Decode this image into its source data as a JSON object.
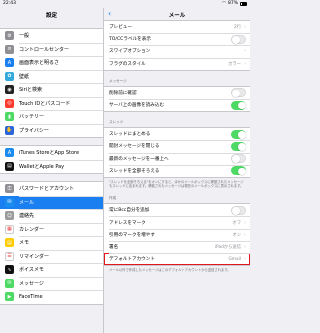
{
  "status": {
    "time": "22:43",
    "battery": "87%"
  },
  "left": {
    "title": "設定",
    "groups": [
      [
        {
          "label": "一般",
          "icon": "gear-icon",
          "color": "#8e8e93"
        },
        {
          "label": "コントロールセンター",
          "icon": "switches-icon",
          "color": "#8e8e93"
        },
        {
          "label": "画面表示と明るさ",
          "icon": "aa-icon",
          "color": "#1a7ff0"
        },
        {
          "label": "壁紙",
          "icon": "flower-icon",
          "color": "#34aadc"
        },
        {
          "label": "Siriと検索",
          "icon": "siri-icon",
          "color": "#222"
        },
        {
          "label": "Touch IDとパスコード",
          "icon": "fingerprint-icon",
          "color": "#ff3b30"
        },
        {
          "label": "バッテリー",
          "icon": "battery-icon",
          "color": "#4cd964"
        },
        {
          "label": "プライバシー",
          "icon": "hand-icon",
          "color": "#2a66d9"
        }
      ],
      [
        {
          "label": "iTunes StoreとApp Store",
          "icon": "appstore-icon",
          "color": "#1a8cf0"
        },
        {
          "label": "WalletとApple Pay",
          "icon": "wallet-icon",
          "color": "#111"
        }
      ],
      [
        {
          "label": "パスワードとアカウント",
          "icon": "key-icon",
          "color": "#8e8e93"
        },
        {
          "label": "メール",
          "icon": "mail-icon",
          "color": "#1a8cf0",
          "selected": true
        },
        {
          "label": "連絡先",
          "icon": "contacts-icon",
          "color": "#9b9b9b"
        },
        {
          "label": "カレンダー",
          "icon": "calendar-icon",
          "color": "#fff"
        },
        {
          "label": "メモ",
          "icon": "notes-icon",
          "color": "#ffcc00"
        },
        {
          "label": "リマインダー",
          "icon": "reminders-icon",
          "color": "#fff"
        },
        {
          "label": "ボイスメモ",
          "icon": "voicememo-icon",
          "color": "#111"
        },
        {
          "label": "メッセージ",
          "icon": "message-icon",
          "color": "#4cd964"
        },
        {
          "label": "FaceTime",
          "icon": "facetime-icon",
          "color": "#4cd964"
        }
      ]
    ]
  },
  "right": {
    "title": "メール",
    "back_icon": "chevron-left-icon",
    "group1": [
      {
        "label": "プレビュー",
        "value": "2行",
        "type": "nav"
      },
      {
        "label": "TO/CCラベルを表示",
        "type": "toggle",
        "on": false
      },
      {
        "label": "スワイプオプション",
        "type": "nav"
      },
      {
        "label": "フラグのスタイル",
        "value": "カラー",
        "type": "nav"
      }
    ],
    "section2": "メッセージ",
    "group2": [
      {
        "label": "削除前に確認",
        "type": "toggle",
        "on": false
      },
      {
        "label": "サーバ上の画像を読み込む",
        "type": "toggle",
        "on": true
      }
    ],
    "section3": "スレッド",
    "group3": [
      {
        "label": "スレッドにまとめる",
        "type": "toggle",
        "on": true
      },
      {
        "label": "開封メッセージを閉じる",
        "type": "toggle",
        "on": true
      },
      {
        "label": "最新のメッセージを一番上へ",
        "type": "toggle",
        "on": false
      },
      {
        "label": "スレッドを全部そろえる",
        "type": "toggle",
        "on": true
      }
    ],
    "footer3": "\"スレッドを全部そろえる\"をオンにすると、ほかのメールボックスに移動されたメッセージもスレッドに含まれます。移動されたメッセージは現在のメールボックスに表示されます。",
    "section4": "作成",
    "group4": [
      {
        "label": "常にBcc自分を追加",
        "type": "toggle",
        "on": false
      },
      {
        "label": "アドレスをマーク",
        "value": "オフ",
        "type": "nav"
      },
      {
        "label": "引用のマークを増やす",
        "value": "オン",
        "type": "nav"
      },
      {
        "label": "署名",
        "value": "iPadから送信",
        "type": "nav"
      },
      {
        "label": "デフォルトアカウント",
        "value": "Gmail",
        "type": "nav",
        "highlight": true
      }
    ],
    "footer4": "メール以外で作成したメッセージはこのデフォルトアカウントから送信されます。"
  }
}
